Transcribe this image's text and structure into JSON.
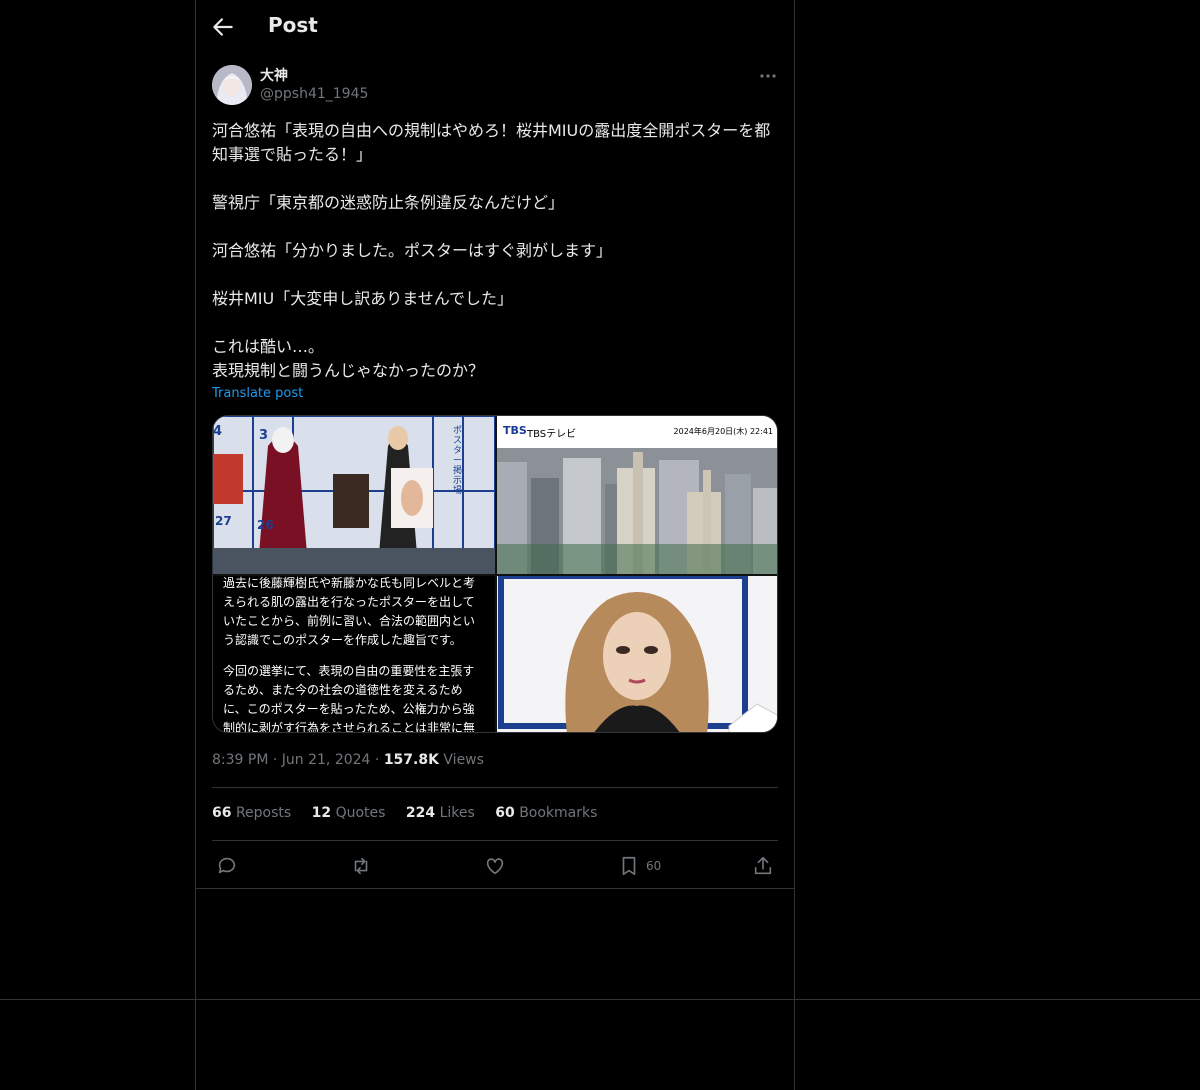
{
  "header": {
    "title": "Post"
  },
  "author": {
    "name": "大神",
    "handle": "@ppsh41_1945"
  },
  "tweet": {
    "text": "河合悠祐「表現の自由への規制はやめろ！桜井MIUの露出度全開ポスターを都知事選で貼ったる！」\n\n警視庁「東京都の迷惑防止条例違反なんだけど」\n\n河合悠祐「分かりました。ポスターはすぐ剥がします」\n\n桜井MIU「大変申し訳ありませんでした」\n\nこれは酷い…。\n表現規制と闘うんじゃなかったのか？",
    "translate_label": "Translate post"
  },
  "media": {
    "tbs_logo": "TBS",
    "tbs_name": "TBSテレビ",
    "tbs_date": "2024年6月20日(木) 22:41",
    "board_numbers": [
      "4",
      "3",
      "27",
      "26"
    ],
    "poster_side_text": "ポスター掲示場",
    "statement_p1": "過去に後藤輝樹氏や新藤かな氏も同レベルと考えられる肌の露出を行なったポスターを出していたことから、前例に習い、合法の範囲内という認識でこのポスターを作成した趣旨です。",
    "statement_p2": "今回の選挙にて、表現の自由の重要性を主張するため、また今の社会の道徳性を変えるために、このポスターを貼ったため、公権力から強制的に剥がす行為をさせられることは非常に無"
  },
  "meta": {
    "time": "8:39 PM",
    "date": "Jun 21, 2024",
    "views_count": "157.8K",
    "views_label": "Views"
  },
  "stats": {
    "reposts_count": "66",
    "reposts_label": "Reposts",
    "quotes_count": "12",
    "quotes_label": "Quotes",
    "likes_count": "224",
    "likes_label": "Likes",
    "bookmarks_count": "60",
    "bookmarks_label": "Bookmarks"
  },
  "actions": {
    "bookmark_count": "60"
  },
  "colors": {
    "background": "#000000",
    "border": "#2f3336",
    "link": "#1d9bf0",
    "muted": "#71767b",
    "text": "#e7e9ea"
  }
}
